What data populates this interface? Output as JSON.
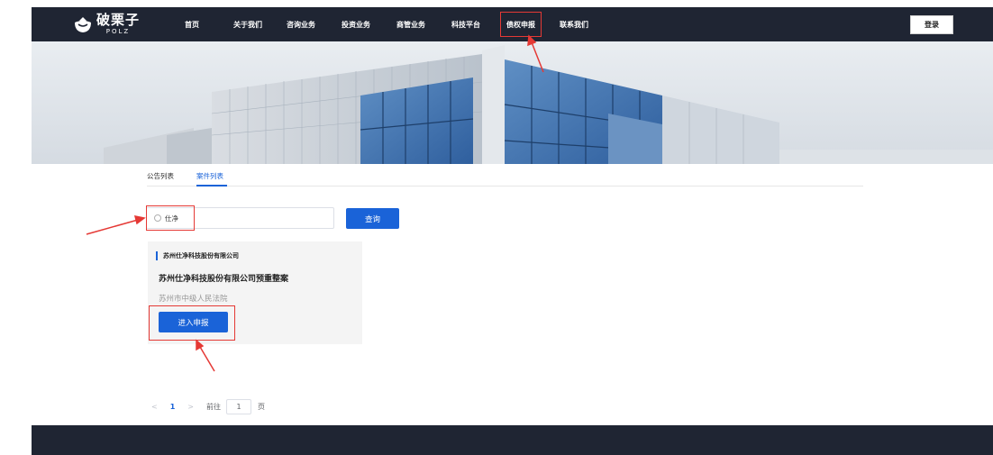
{
  "header": {
    "logo_cn": "破栗子",
    "logo_en": "POLZ",
    "nav": [
      {
        "label": "首页",
        "active": false
      },
      {
        "label": "关于我们",
        "active": false
      },
      {
        "label": "咨询业务",
        "active": false
      },
      {
        "label": "投资业务",
        "active": false
      },
      {
        "label": "商管业务",
        "active": false
      },
      {
        "label": "科技平台",
        "active": false
      },
      {
        "label": "债权申报",
        "active": true
      },
      {
        "label": "联系我们",
        "active": false
      }
    ],
    "login_label": "登录"
  },
  "tabs": [
    "公告列表",
    "案件列表"
  ],
  "active_tab": "案件列表",
  "search": {
    "value": "仕净",
    "button_label": "查询"
  },
  "card": {
    "company": "苏州仕净科技股份有限公司",
    "title": "苏州仕净科技股份有限公司预重整案",
    "court": "苏州市中级人民法院",
    "button_label": "进入申报"
  },
  "pagination": {
    "prev": "<",
    "current": "1",
    "next": ">",
    "goto_label": "前往",
    "goto_value": "1",
    "page_suffix": "页"
  },
  "colors": {
    "header_bg": "#1f2533",
    "primary": "#1a63d8",
    "annotation": "#e53935"
  }
}
